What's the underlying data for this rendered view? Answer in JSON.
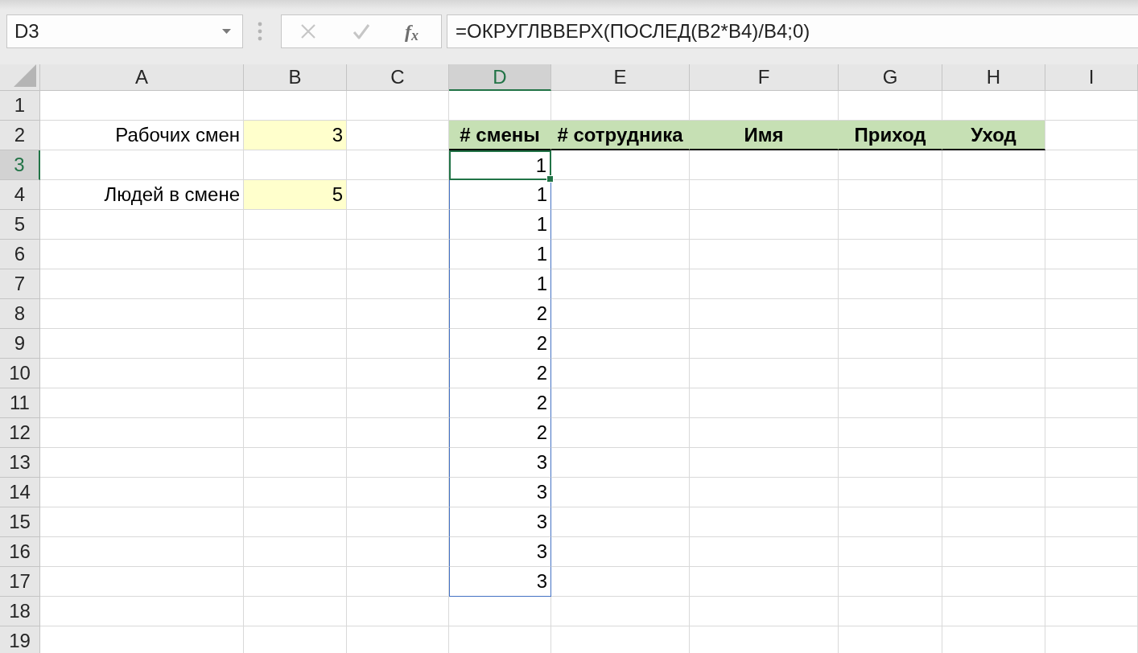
{
  "formula_bar": {
    "name_box": "D3",
    "buttons": [
      {
        "kind": "cancel",
        "disabled": true
      },
      {
        "kind": "enter",
        "disabled": true
      },
      {
        "kind": "function",
        "label": "f$_{x}$",
        "disabled": false
      }
    ],
    "formula": "=ОКРУГЛВВЕРХ(ПОСЛЕД(B2*B4)/B4;0)"
  },
  "sheet": {
    "columns": [
      {
        "label": "A",
        "selected": false
      },
      {
        "label": "B",
        "selected": false
      },
      {
        "label": "C",
        "selected": false
      },
      {
        "label": "D",
        "selected": true
      },
      {
        "label": "E",
        "selected": false
      },
      {
        "label": "F",
        "selected": false
      },
      {
        "label": "G",
        "selected": false
      },
      {
        "label": "H",
        "selected": false
      },
      {
        "label": "I",
        "selected": false
      }
    ],
    "rows": [
      {
        "label": "1",
        "selected": false
      },
      {
        "label": "2",
        "selected": false
      },
      {
        "label": "3",
        "selected": true
      },
      {
        "label": "4",
        "selected": false
      },
      {
        "label": "5",
        "selected": false
      },
      {
        "label": "6",
        "selected": false
      },
      {
        "label": "7",
        "selected": false
      },
      {
        "label": "8",
        "selected": false
      },
      {
        "label": "9",
        "selected": false
      },
      {
        "label": "10",
        "selected": false
      },
      {
        "label": "11",
        "selected": false
      },
      {
        "label": "12",
        "selected": false
      },
      {
        "label": "13",
        "selected": false
      },
      {
        "label": "14",
        "selected": false
      },
      {
        "label": "15",
        "selected": false
      },
      {
        "label": "16",
        "selected": false
      },
      {
        "label": "17",
        "selected": false
      },
      {
        "label": "18",
        "selected": false
      },
      {
        "label": "19",
        "selected": false
      }
    ],
    "parameters": [
      {
        "label": "Рабочих смен",
        "value": "3"
      },
      {
        "label": "Людей в смене",
        "value": "5"
      }
    ],
    "table": {
      "headers": [
        "# смены",
        "# сотрудника",
        "Имя",
        "Приход",
        "Уход"
      ],
      "shift_numbers": [
        {
          "value": "1",
          "selected": true
        },
        {
          "value": "1",
          "selected": false
        },
        {
          "value": "1",
          "selected": false
        },
        {
          "value": "1",
          "selected": false
        },
        {
          "value": "1",
          "selected": false
        },
        {
          "value": "2",
          "selected": false
        },
        {
          "value": "2",
          "selected": false
        },
        {
          "value": "2",
          "selected": false
        },
        {
          "value": "2",
          "selected": false
        },
        {
          "value": "2",
          "selected": false
        },
        {
          "value": "3",
          "selected": false
        },
        {
          "value": "3",
          "selected": false
        },
        {
          "value": "3",
          "selected": false
        },
        {
          "value": "3",
          "selected": false
        },
        {
          "value": "3",
          "selected": false
        }
      ]
    }
  }
}
